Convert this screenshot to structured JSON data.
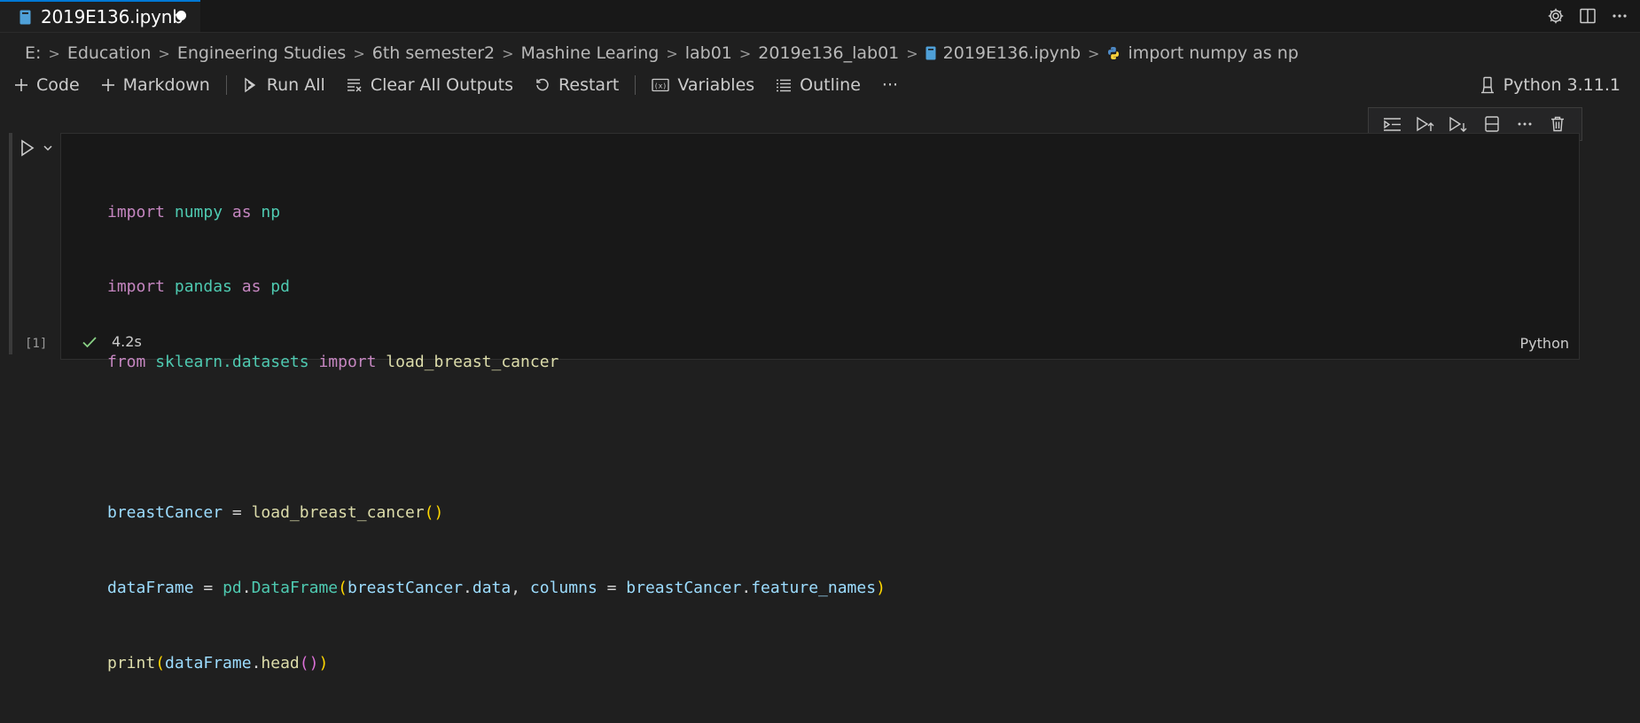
{
  "tab": {
    "title": "2019E136.ipynb",
    "dirty": true
  },
  "breadcrumb": [
    "E:",
    "Education",
    "Engineering Studies",
    "6th semester2",
    "Mashine Learing",
    "lab01",
    "2019e136_lab01",
    "2019E136.ipynb",
    "import numpy as np"
  ],
  "toolbar": {
    "code": "Code",
    "markdown": "Markdown",
    "run_all": "Run All",
    "clear_outputs": "Clear All Outputs",
    "restart": "Restart",
    "variables": "Variables",
    "outline": "Outline",
    "more": "···"
  },
  "kernel": {
    "label": "Python 3.11.1"
  },
  "cell": {
    "execution_count": "[1]",
    "duration": "4.2s",
    "language": "Python",
    "code_lines": [
      "import numpy as np",
      "import pandas as pd",
      "from sklearn.datasets import load_breast_cancer",
      "",
      "breastCancer = load_breast_cancer()",
      "dataFrame = pd.DataFrame(breastCancer.data, columns = breastCancer.feature_names)",
      "print(dataFrame.head())"
    ],
    "tokens": {
      "l1": [
        "import",
        " numpy ",
        "as",
        " np"
      ],
      "l2": [
        "import",
        " pandas ",
        "as",
        " pd"
      ],
      "l3": [
        "from",
        " sklearn.datasets ",
        "import",
        " load_breast_cancer"
      ],
      "l5": [
        "breastCancer",
        " = ",
        "load_breast_cancer",
        "(",
        ")"
      ],
      "l6": [
        "dataFrame",
        " = ",
        "pd",
        ".",
        "DataFrame",
        "(",
        "breastCancer",
        ".",
        "data",
        ", ",
        "columns",
        " = ",
        "breastCancer",
        ".",
        "feature_names",
        ")"
      ],
      "l7": [
        "print",
        "(",
        "dataFrame",
        ".",
        "head",
        "(",
        ")",
        ")"
      ]
    }
  },
  "colors": {
    "accent": "#0078d4",
    "success": "#89d185",
    "keyword": "#c586c0",
    "module": "#4ec9b0",
    "variable": "#9cdcfe",
    "function": "#dcdcaa"
  }
}
